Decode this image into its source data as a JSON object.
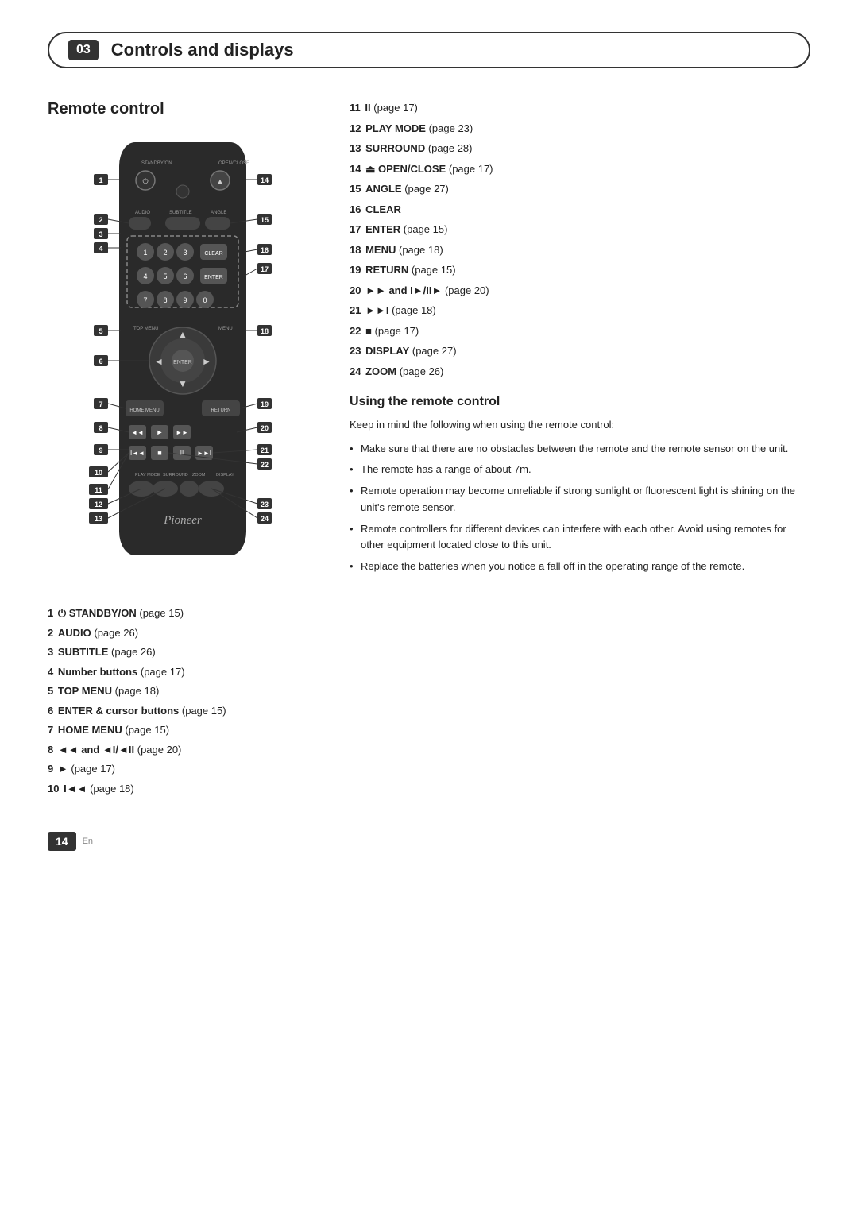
{
  "chapter": {
    "number": "03",
    "title": "Controls and displays"
  },
  "section": {
    "remote_control_title": "Remote control",
    "using_title": "Using the remote control",
    "using_intro": "Keep in mind the following when using the remote control:"
  },
  "left_descriptions": [
    {
      "num": "1",
      "bold": "STANDBY/ON",
      "rest": " (page 15)"
    },
    {
      "num": "2",
      "bold": "AUDIO",
      "rest": " (page 26)"
    },
    {
      "num": "3",
      "bold": "SUBTITLE",
      "rest": " (page 26)"
    },
    {
      "num": "4",
      "bold": "Number buttons",
      "rest": " (page 17)"
    },
    {
      "num": "5",
      "bold": "TOP MENU",
      "rest": " (page 18)"
    },
    {
      "num": "6",
      "bold": "ENTER & cursor buttons",
      "rest": " (page 15)"
    },
    {
      "num": "7",
      "bold": "HOME MENU",
      "rest": " (page 15)"
    },
    {
      "num": "8",
      "bold": "◄◄ and ◄I/◄II",
      "rest": " (page 20)"
    },
    {
      "num": "9",
      "bold": "►",
      "rest": " (page 17)"
    },
    {
      "num": "10",
      "bold": "I◄◄",
      "rest": " (page 18)"
    }
  ],
  "right_descriptions": [
    {
      "num": "11",
      "bold": "II",
      "rest": " (page 17)"
    },
    {
      "num": "12",
      "bold": "PLAY MODE",
      "rest": " (page 23)"
    },
    {
      "num": "13",
      "bold": "SURROUND",
      "rest": " (page 28)"
    },
    {
      "num": "14",
      "bold": "⏏ OPEN/CLOSE",
      "rest": " (page 17)"
    },
    {
      "num": "15",
      "bold": "ANGLE",
      "rest": " (page 27)"
    },
    {
      "num": "16",
      "bold": "CLEAR",
      "rest": ""
    },
    {
      "num": "17",
      "bold": "ENTER",
      "rest": " (page 15)"
    },
    {
      "num": "18",
      "bold": "MENU",
      "rest": " (page 18)"
    },
    {
      "num": "19",
      "bold": "RETURN",
      "rest": " (page 15)"
    },
    {
      "num": "20",
      "bold": "►► and I►/II►",
      "rest": " (page 20)"
    },
    {
      "num": "21",
      "bold": "►►I",
      "rest": " (page 18)"
    },
    {
      "num": "22",
      "bold": "■",
      "rest": " (page 17)"
    },
    {
      "num": "23",
      "bold": "DISPLAY",
      "rest": " (page 27)"
    },
    {
      "num": "24",
      "bold": "ZOOM",
      "rest": " (page 26)"
    }
  ],
  "bullets": [
    "Make sure that there are no obstacles between the remote and the remote sensor on the unit.",
    "The remote has a range of about 7m.",
    "Remote operation may become unreliable if strong sunlight or fluorescent light is shining on the unit's remote sensor.",
    "Remote controllers for different devices can interfere with each other. Avoid using remotes for other equipment located close to this unit.",
    "Replace the batteries when you notice a fall off in the operating range of the remote."
  ],
  "footer": {
    "page_number": "14",
    "lang": "En"
  },
  "remote": {
    "labels": {
      "standby": "STANDBY/ON",
      "open_close": "OPEN/CLOSE",
      "audio": "AUDIO",
      "subtitle": "SUBTITLE",
      "angle": "ANGLE",
      "top_menu": "TOP MENU",
      "menu": "MENU",
      "home_menu": "HOME MENU",
      "return": "RETURN",
      "enter": "ENTER",
      "play_mode": "PLAY MODE",
      "surround": "SURROUND",
      "zoom": "ZOOM",
      "display": "DISPLAY",
      "clear": "CLEAR",
      "pioneer": "Pioneer"
    },
    "number_annotations_left": [
      "1",
      "2",
      "3",
      "4",
      "5",
      "6",
      "7",
      "8",
      "9",
      "10",
      "11",
      "12",
      "13"
    ],
    "number_annotations_right": [
      "14",
      "15",
      "16",
      "17",
      "18",
      "19",
      "20",
      "21",
      "22",
      "23",
      "24"
    ]
  }
}
